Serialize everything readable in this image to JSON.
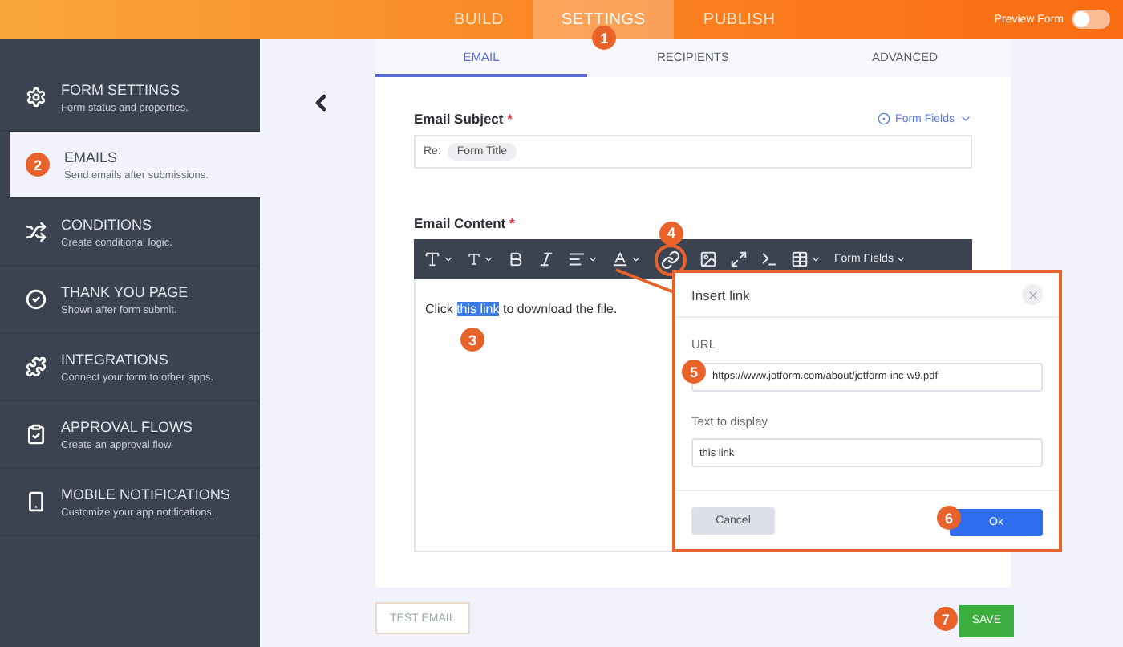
{
  "top_bar": {
    "tabs": [
      {
        "label": "BUILD",
        "selected": false
      },
      {
        "label": "SETTINGS",
        "selected": true,
        "badge": "1"
      },
      {
        "label": "PUBLISH",
        "selected": false
      }
    ],
    "preview": {
      "label": "Preview Form",
      "on": false
    }
  },
  "sidebar": {
    "items": [
      {
        "kind": "gear",
        "title": "FORM SETTINGS",
        "subtitle": "Form status and properties.",
        "selected": false
      },
      {
        "badge": "2",
        "title": "EMAILS",
        "subtitle": "Send emails after submissions.",
        "selected": true
      },
      {
        "kind": "shuffle",
        "title": "CONDITIONS",
        "subtitle": "Create conditional logic.",
        "selected": false
      },
      {
        "kind": "check",
        "title": "THANK YOU PAGE",
        "subtitle": "Shown after form submit.",
        "selected": false
      },
      {
        "kind": "puzzle",
        "title": "INTEGRATIONS",
        "subtitle": "Connect your form to other apps.",
        "selected": false
      },
      {
        "kind": "clipboard",
        "title": "APPROVAL FLOWS",
        "subtitle": "Create an approval flow.",
        "selected": false
      },
      {
        "kind": "phone",
        "title": "MOBILE NOTIFICATIONS",
        "subtitle": "Customize your app notifications.",
        "selected": false
      }
    ]
  },
  "card": {
    "tabs": [
      {
        "label": "EMAIL",
        "selected": true
      },
      {
        "label": "RECIPIENTS",
        "selected": false
      },
      {
        "label": "ADVANCED",
        "selected": false
      }
    ],
    "subject": {
      "label": "Email Subject",
      "required_mark": "*",
      "form_fields": "Form Fields",
      "prefix": "Re:",
      "chip": "Form Title"
    },
    "content": {
      "label": "Email Content",
      "required_mark": "*",
      "toolbar_form_fields": "Form Fields",
      "link_badge": "4",
      "text_before": "Click",
      "link": {
        "text": "this link",
        "selected": true,
        "badge": "3"
      },
      "text_after": "to download the file."
    }
  },
  "dialog": {
    "title": "Insert link",
    "fields": [
      {
        "label": "URL",
        "value": "https://www.jotform.com/about/jotform-inc-w9.pdf",
        "badge": "5"
      },
      {
        "label": "Text to display",
        "value": "this link"
      }
    ],
    "cancel": "Cancel",
    "ok": {
      "label": "Ok",
      "badge": "6"
    }
  },
  "footer": {
    "test_email": "TEST EMAIL",
    "save": {
      "label": "SAVE",
      "badge": "7"
    }
  }
}
